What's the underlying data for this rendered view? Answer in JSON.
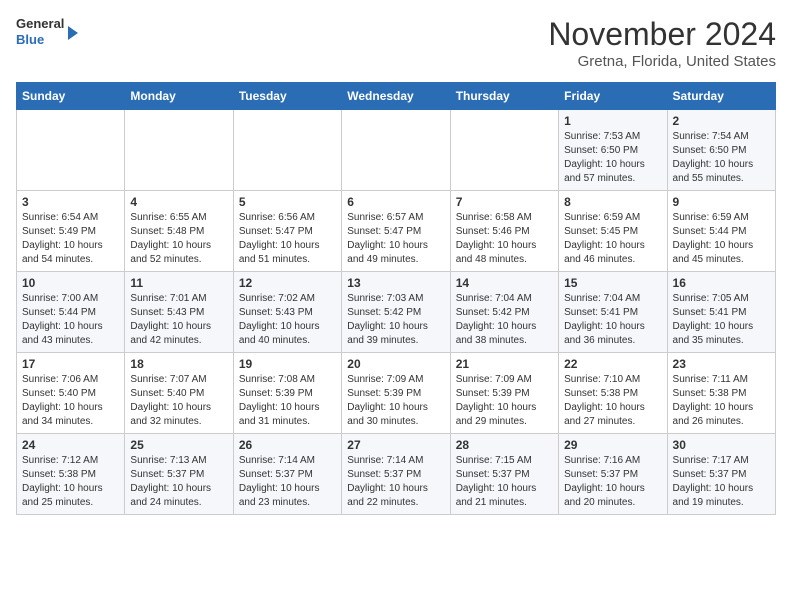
{
  "header": {
    "logo_general": "General",
    "logo_blue": "Blue",
    "title": "November 2024",
    "subtitle": "Gretna, Florida, United States"
  },
  "days_of_week": [
    "Sunday",
    "Monday",
    "Tuesday",
    "Wednesday",
    "Thursday",
    "Friday",
    "Saturday"
  ],
  "weeks": [
    [
      {
        "day": "",
        "info": ""
      },
      {
        "day": "",
        "info": ""
      },
      {
        "day": "",
        "info": ""
      },
      {
        "day": "",
        "info": ""
      },
      {
        "day": "",
        "info": ""
      },
      {
        "day": "1",
        "info": "Sunrise: 7:53 AM\nSunset: 6:50 PM\nDaylight: 10 hours\nand 57 minutes."
      },
      {
        "day": "2",
        "info": "Sunrise: 7:54 AM\nSunset: 6:50 PM\nDaylight: 10 hours\nand 55 minutes."
      }
    ],
    [
      {
        "day": "3",
        "info": "Sunrise: 6:54 AM\nSunset: 5:49 PM\nDaylight: 10 hours\nand 54 minutes."
      },
      {
        "day": "4",
        "info": "Sunrise: 6:55 AM\nSunset: 5:48 PM\nDaylight: 10 hours\nand 52 minutes."
      },
      {
        "day": "5",
        "info": "Sunrise: 6:56 AM\nSunset: 5:47 PM\nDaylight: 10 hours\nand 51 minutes."
      },
      {
        "day": "6",
        "info": "Sunrise: 6:57 AM\nSunset: 5:47 PM\nDaylight: 10 hours\nand 49 minutes."
      },
      {
        "day": "7",
        "info": "Sunrise: 6:58 AM\nSunset: 5:46 PM\nDaylight: 10 hours\nand 48 minutes."
      },
      {
        "day": "8",
        "info": "Sunrise: 6:59 AM\nSunset: 5:45 PM\nDaylight: 10 hours\nand 46 minutes."
      },
      {
        "day": "9",
        "info": "Sunrise: 6:59 AM\nSunset: 5:44 PM\nDaylight: 10 hours\nand 45 minutes."
      }
    ],
    [
      {
        "day": "10",
        "info": "Sunrise: 7:00 AM\nSunset: 5:44 PM\nDaylight: 10 hours\nand 43 minutes."
      },
      {
        "day": "11",
        "info": "Sunrise: 7:01 AM\nSunset: 5:43 PM\nDaylight: 10 hours\nand 42 minutes."
      },
      {
        "day": "12",
        "info": "Sunrise: 7:02 AM\nSunset: 5:43 PM\nDaylight: 10 hours\nand 40 minutes."
      },
      {
        "day": "13",
        "info": "Sunrise: 7:03 AM\nSunset: 5:42 PM\nDaylight: 10 hours\nand 39 minutes."
      },
      {
        "day": "14",
        "info": "Sunrise: 7:04 AM\nSunset: 5:42 PM\nDaylight: 10 hours\nand 38 minutes."
      },
      {
        "day": "15",
        "info": "Sunrise: 7:04 AM\nSunset: 5:41 PM\nDaylight: 10 hours\nand 36 minutes."
      },
      {
        "day": "16",
        "info": "Sunrise: 7:05 AM\nSunset: 5:41 PM\nDaylight: 10 hours\nand 35 minutes."
      }
    ],
    [
      {
        "day": "17",
        "info": "Sunrise: 7:06 AM\nSunset: 5:40 PM\nDaylight: 10 hours\nand 34 minutes."
      },
      {
        "day": "18",
        "info": "Sunrise: 7:07 AM\nSunset: 5:40 PM\nDaylight: 10 hours\nand 32 minutes."
      },
      {
        "day": "19",
        "info": "Sunrise: 7:08 AM\nSunset: 5:39 PM\nDaylight: 10 hours\nand 31 minutes."
      },
      {
        "day": "20",
        "info": "Sunrise: 7:09 AM\nSunset: 5:39 PM\nDaylight: 10 hours\nand 30 minutes."
      },
      {
        "day": "21",
        "info": "Sunrise: 7:09 AM\nSunset: 5:39 PM\nDaylight: 10 hours\nand 29 minutes."
      },
      {
        "day": "22",
        "info": "Sunrise: 7:10 AM\nSunset: 5:38 PM\nDaylight: 10 hours\nand 27 minutes."
      },
      {
        "day": "23",
        "info": "Sunrise: 7:11 AM\nSunset: 5:38 PM\nDaylight: 10 hours\nand 26 minutes."
      }
    ],
    [
      {
        "day": "24",
        "info": "Sunrise: 7:12 AM\nSunset: 5:38 PM\nDaylight: 10 hours\nand 25 minutes."
      },
      {
        "day": "25",
        "info": "Sunrise: 7:13 AM\nSunset: 5:37 PM\nDaylight: 10 hours\nand 24 minutes."
      },
      {
        "day": "26",
        "info": "Sunrise: 7:14 AM\nSunset: 5:37 PM\nDaylight: 10 hours\nand 23 minutes."
      },
      {
        "day": "27",
        "info": "Sunrise: 7:14 AM\nSunset: 5:37 PM\nDaylight: 10 hours\nand 22 minutes."
      },
      {
        "day": "28",
        "info": "Sunrise: 7:15 AM\nSunset: 5:37 PM\nDaylight: 10 hours\nand 21 minutes."
      },
      {
        "day": "29",
        "info": "Sunrise: 7:16 AM\nSunset: 5:37 PM\nDaylight: 10 hours\nand 20 minutes."
      },
      {
        "day": "30",
        "info": "Sunrise: 7:17 AM\nSunset: 5:37 PM\nDaylight: 10 hours\nand 19 minutes."
      }
    ]
  ]
}
